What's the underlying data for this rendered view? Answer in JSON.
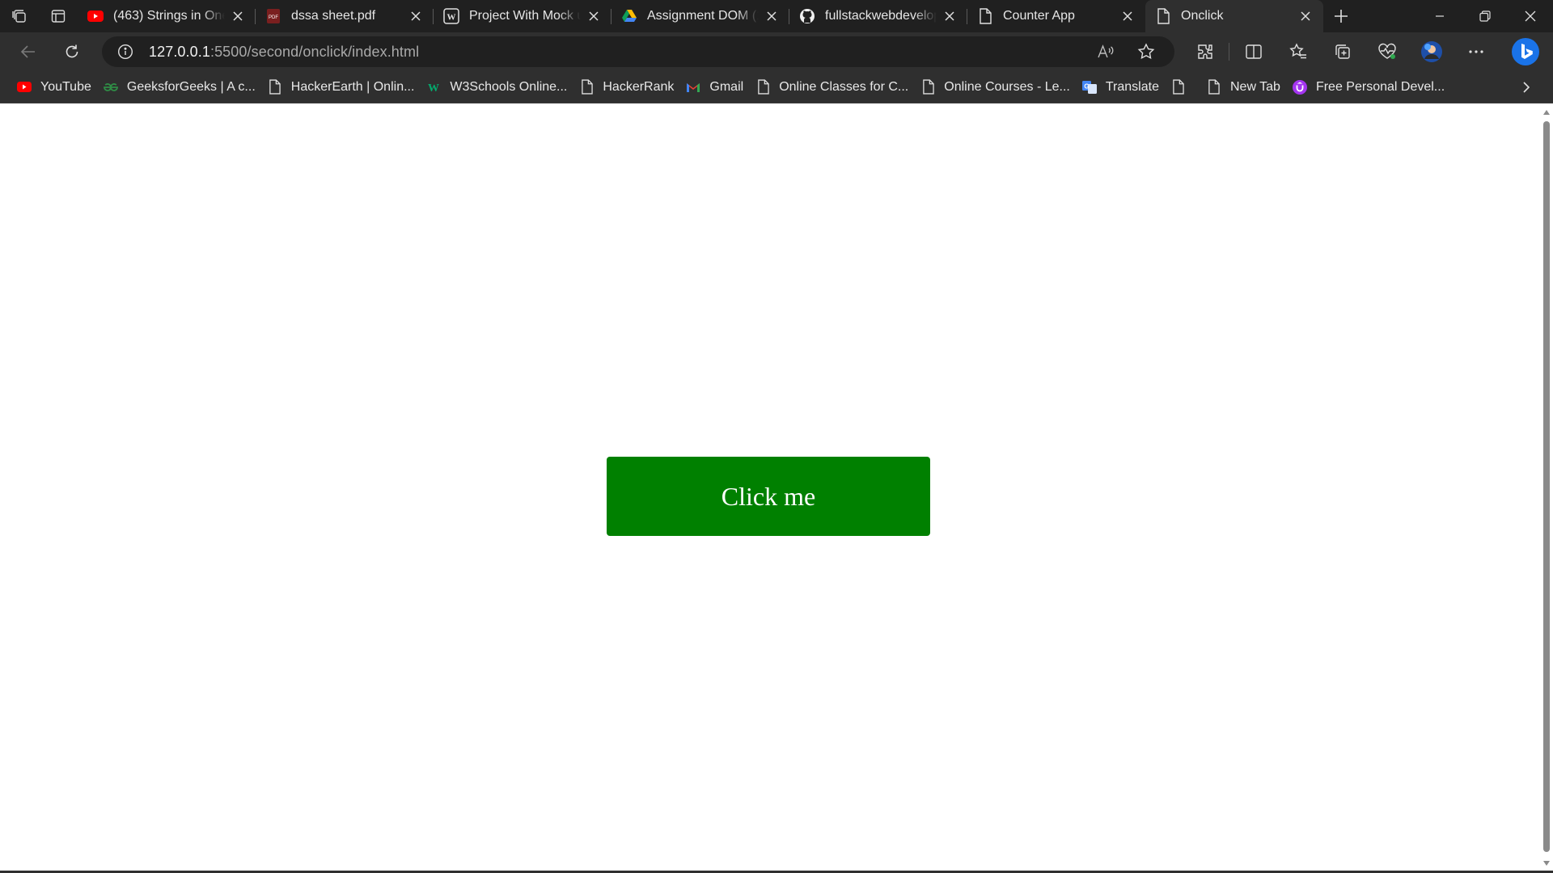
{
  "tabs": [
    {
      "title": "(463) Strings in One Shot",
      "icon": "youtube-icon",
      "active": false
    },
    {
      "title": "dssa sheet.pdf",
      "icon": "pdf-icon",
      "active": false
    },
    {
      "title": "Project With Mock up",
      "icon": "wordpress-icon",
      "active": false
    },
    {
      "title": "Assignment DOM (1)",
      "icon": "google-drive-icon",
      "active": false
    },
    {
      "title": "fullstackwebdeveloper",
      "icon": "github-icon",
      "active": false
    },
    {
      "title": "Counter App",
      "icon": "page-icon",
      "active": false
    },
    {
      "title": "Onclick",
      "icon": "page-icon",
      "active": true
    }
  ],
  "address": {
    "host": "127.0.0.1",
    "path": ":5500/second/onclick/index.html"
  },
  "favorites": [
    {
      "label": "YouTube",
      "icon": "youtube-icon"
    },
    {
      "label": "GeeksforGeeks | A c...",
      "icon": "geeksforgeeks-icon"
    },
    {
      "label": "HackerEarth | Onlin...",
      "icon": "page-icon"
    },
    {
      "label": "W3Schools Online...",
      "icon": "w3schools-icon"
    },
    {
      "label": "HackerRank",
      "icon": "page-icon"
    },
    {
      "label": "Gmail",
      "icon": "gmail-icon"
    },
    {
      "label": "Online Classes for C...",
      "icon": "page-icon"
    },
    {
      "label": "Online Courses - Le...",
      "icon": "page-icon"
    },
    {
      "label": "Translate",
      "icon": "translate-icon"
    },
    {
      "label": "",
      "icon": "page-icon"
    },
    {
      "label": "New Tab",
      "icon": "page-icon"
    },
    {
      "label": "Free Personal Devel...",
      "icon": "udemy-icon"
    }
  ],
  "page": {
    "button_label": "Click me"
  },
  "colors": {
    "button_bg": "#008000",
    "page_bg": "#ffffff",
    "chrome_bg": "#202020",
    "toolbar_bg": "#2f2f2f"
  }
}
